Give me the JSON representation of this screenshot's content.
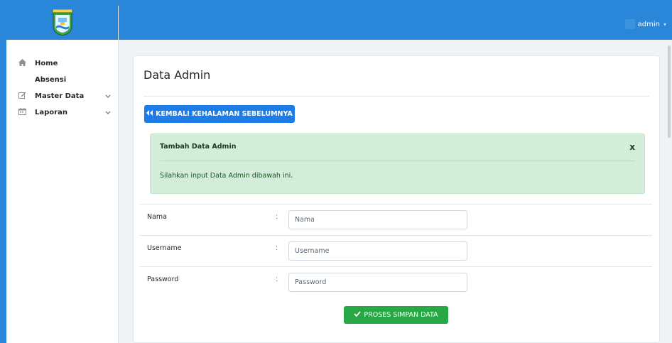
{
  "colors": {
    "accent": "#2a86d8",
    "primary_button": "#1e7ce6",
    "success_button": "#28a745",
    "alert_bg": "#d4edda",
    "page_bg": "#f0f3f5"
  },
  "header": {
    "user_label": "admin",
    "caret_icon": "caret-down-icon"
  },
  "sidebar": {
    "logo_icon": "regional-emblem-logo",
    "items": [
      {
        "label": "Home",
        "icon": "home-icon",
        "has_children": false
      },
      {
        "label": "Absensi",
        "icon": "",
        "has_children": false
      },
      {
        "label": "Master Data",
        "icon": "edit-icon",
        "has_children": true
      },
      {
        "label": "Laporan",
        "icon": "calendar-icon",
        "has_children": true
      }
    ]
  },
  "main": {
    "title": "Data Admin",
    "back_button_label": "KEMBALI KEHALAMAN SEBELUMNYA",
    "back_button_icon": "double-chevron-left-icon",
    "alert": {
      "title": "Tambah Data Admin",
      "close_label": "x",
      "message": "Silahkan input Data Admin dibawah ini."
    },
    "form": {
      "fields": [
        {
          "label": "Nama",
          "separator": ":",
          "placeholder": "Nama",
          "value": ""
        },
        {
          "label": "Username",
          "separator": ":",
          "placeholder": "Username",
          "value": ""
        },
        {
          "label": "Password",
          "separator": ":",
          "placeholder": "Password",
          "value": ""
        }
      ],
      "submit_label": "PROSES SIMPAN DATA",
      "submit_icon": "checkmark-icon"
    }
  }
}
